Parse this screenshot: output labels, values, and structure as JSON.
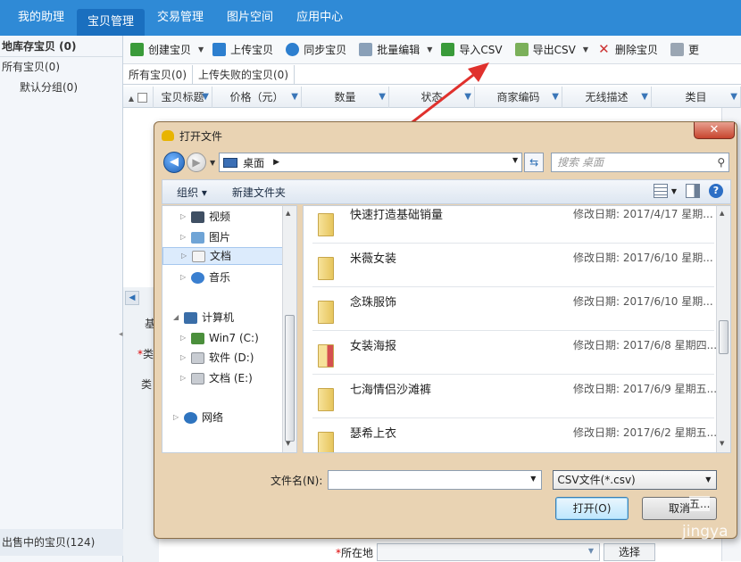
{
  "topnav": {
    "items": [
      {
        "label": "我的助理",
        "active": false
      },
      {
        "label": "宝贝管理",
        "active": true
      },
      {
        "label": "交易管理",
        "active": false
      },
      {
        "label": "图片空间",
        "active": false
      },
      {
        "label": "应用中心",
        "active": false
      }
    ]
  },
  "left": {
    "title": "地库存宝贝 (0)",
    "all": "所有宝贝(0)",
    "default_group": "默认分组(0)",
    "on_sale": "出售中的宝贝(124)"
  },
  "toolbar": {
    "create": "创建宝贝",
    "upload": "上传宝贝",
    "sync": "同步宝贝",
    "batch_edit": "批量编辑",
    "import_csv": "导入CSV",
    "export_csv": "导出CSV",
    "delete": "删除宝贝",
    "more": "更"
  },
  "subtabs": [
    "所有宝贝(0)",
    "上传失败的宝贝(0)"
  ],
  "table": {
    "columns": [
      "宝贝标题",
      "价格（元）",
      "数量",
      "状态",
      "商家编码",
      "无线描述",
      "类目"
    ]
  },
  "background": {
    "frag_basic": "基",
    "frag_category": "类",
    "frag_category2": "类",
    "location_label": "所在地",
    "select_button": "选择",
    "frag_five": "五..."
  },
  "dialog": {
    "title": "打开文件",
    "close": "✕",
    "address": {
      "location": "桌面",
      "search_placeholder": "搜索 桌面"
    },
    "cmdbar": {
      "organize": "组织 ▾",
      "new_folder": "新建文件夹"
    },
    "tree": [
      {
        "label": "视频",
        "icon": "video-icon"
      },
      {
        "label": "图片",
        "icon": "picture-icon"
      },
      {
        "label": "文档",
        "icon": "document-icon",
        "selected": true
      },
      {
        "label": "音乐",
        "icon": "music-icon"
      },
      {
        "label": "计算机",
        "icon": "computer-icon"
      },
      {
        "label": "Win7 (C:)",
        "icon": "windows-drive-icon"
      },
      {
        "label": "软件 (D:)",
        "icon": "drive-icon"
      },
      {
        "label": "文档 (E:)",
        "icon": "drive-icon"
      },
      {
        "label": "网络",
        "icon": "network-icon"
      }
    ],
    "files": [
      {
        "name": "快速打造基础销量",
        "date": "修改日期: 2017/4/17 星期..."
      },
      {
        "name": "米薇女装",
        "date": "修改日期: 2017/6/10 星期..."
      },
      {
        "name": "念珠服饰",
        "date": "修改日期: 2017/6/10 星期..."
      },
      {
        "name": "女装海报",
        "date": "修改日期: 2017/6/8 星期四..."
      },
      {
        "name": "七海情侣沙滩裤",
        "date": "修改日期: 2017/6/9 星期五..."
      },
      {
        "name": "瑟希上衣",
        "date": "修改日期: 2017/6/2 星期五..."
      }
    ],
    "filename_label": "文件名(N):",
    "filename_value": "",
    "filetype": "CSV文件(*.csv)",
    "open_button": "打开(O)",
    "cancel_button": "取消"
  },
  "watermark": "jingya"
}
